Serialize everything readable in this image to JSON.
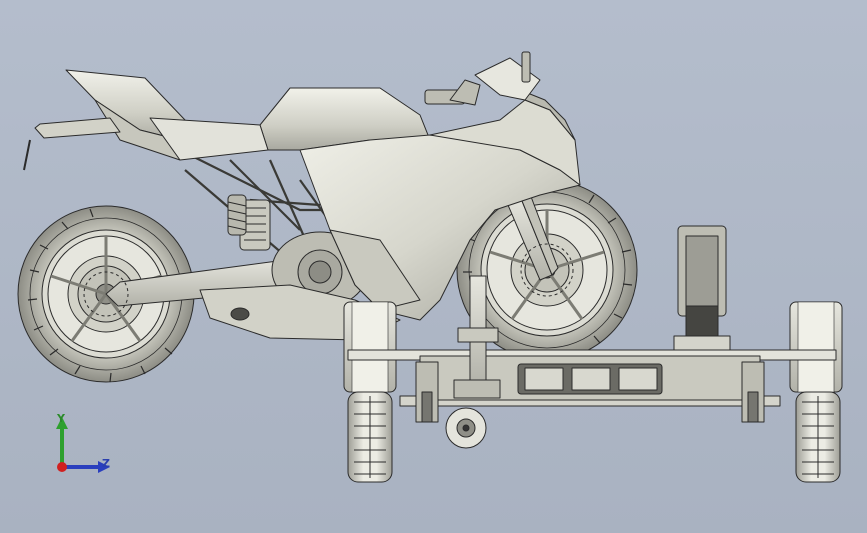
{
  "viewport": {
    "background": "#aeb7c6",
    "model_color": "#d9d9cf",
    "edge_color": "#2b2b2b"
  },
  "axes": {
    "y_label": "Y",
    "z_label": "Z",
    "y_color": "#2ea02e",
    "z_color": "#2a3fbe",
    "x_color": "#d02020"
  },
  "icons": {
    "model": "motorcycle-on-trailer",
    "triad": "coordinate-axes-icon"
  }
}
